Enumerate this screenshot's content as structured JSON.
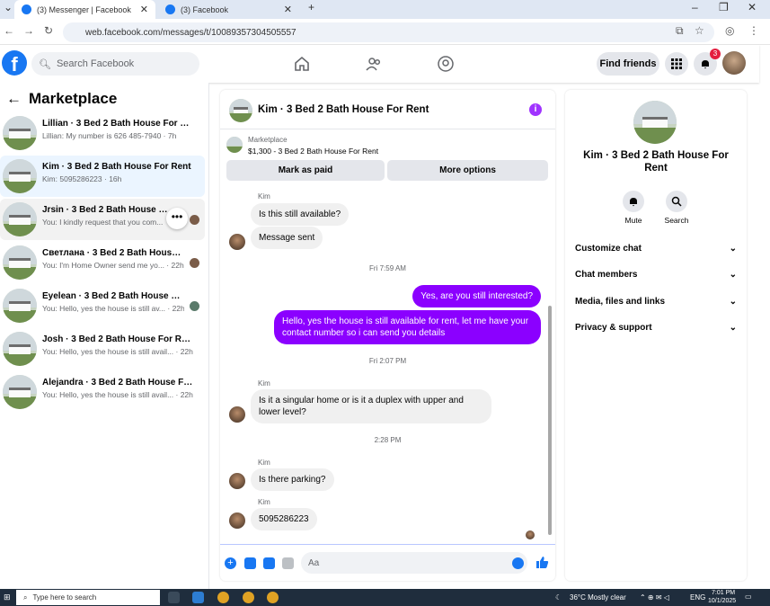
{
  "browser": {
    "tabs": [
      {
        "label": "(3) Messenger | Facebook",
        "active": true
      },
      {
        "label": "(3) Facebook",
        "active": false
      }
    ],
    "new_tab": "+",
    "url": "web.facebook.com/messages/t/10089357304505557"
  },
  "header": {
    "search_placeholder": "Search Facebook",
    "find_friends": "Find friends",
    "notification_count": "3"
  },
  "left": {
    "title": "Marketplace",
    "conversations": [
      {
        "title": "Lillian · 3 Bed 2 Bath House For Rent",
        "sub": "Lillian: My number is 626 485-7940 · 7h"
      },
      {
        "title": "Kim · 3 Bed 2 Bath House For Rent",
        "sub": "Kim: 5095286223 · 16h"
      },
      {
        "title": "Jrsin · 3 Bed 2 Bath House For R",
        "sub": "You: I kindly request that you com..."
      },
      {
        "title": "Светлана · 3 Bed 2 Bath House ...",
        "sub": "You: I'm Home Owner send me yo... · 22h"
      },
      {
        "title": "Eyelean · 3 Bed 2 Bath House Fo...",
        "sub": "You: Hello, yes the house is still av... · 22h"
      },
      {
        "title": "Josh · 3 Bed 2 Bath House For Rent",
        "sub": "You: Hello, yes the house is still avail... · 22h"
      },
      {
        "title": "Alejandra · 3 Bed 2 Bath House Fo...",
        "sub": "You: Hello, yes the house is still avail... · 22h"
      }
    ]
  },
  "chat": {
    "title": "Kim · 3 Bed 2 Bath House For Rent",
    "marketplace_label": "Marketplace",
    "listing": "$1,300 - 3 Bed 2 Bath House For Rent",
    "mark_paid": "Mark as paid",
    "more_options": "More options",
    "messages": {
      "sender": "Kim",
      "m1": "Is this still available?",
      "m2": "Message sent",
      "t1": "Fri 7:59 AM",
      "o1": "Yes, are you still interested?",
      "o2": "Hello, yes the house is still available for rent, let me have your contact number so i can send you  details",
      "t2": "Fri 2:07 PM",
      "m3": "Is it a singular home or is it a duplex with upper and lower level?",
      "t3": "2:28 PM",
      "m4": "Is there parking?",
      "m5": "5095286223"
    },
    "compose_placeholder": "Aa"
  },
  "details": {
    "title": "Kim · 3 Bed 2 Bath House For Rent",
    "mute": "Mute",
    "search": "Search",
    "sections": [
      "Customize chat",
      "Chat members",
      "Media, files and links",
      "Privacy & support"
    ]
  },
  "taskbar": {
    "search": "Type here to search",
    "weather": "36°C  Mostly clear",
    "lang": "ENG",
    "time": "7:01 PM",
    "date": "10/1/2025"
  },
  "colors": {
    "accent": "#1877f2",
    "outgoing": "#8b00ff"
  }
}
